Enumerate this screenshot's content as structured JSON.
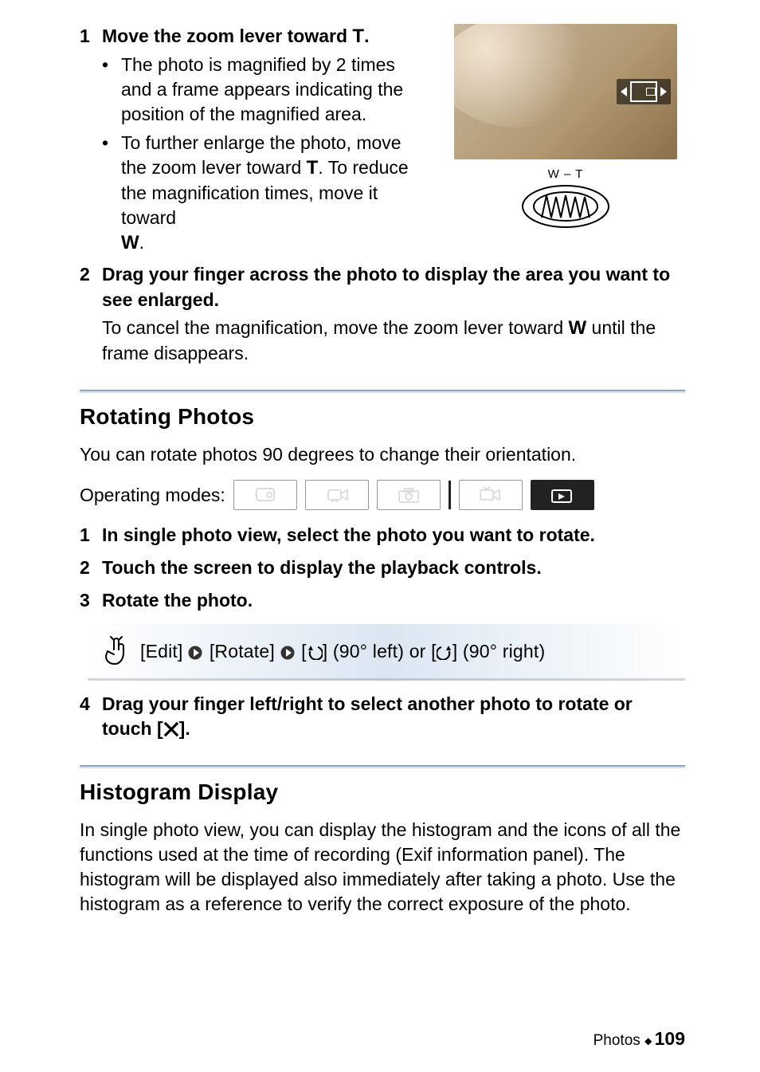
{
  "step1": {
    "num": "1",
    "head_a": "Move the zoom lever toward ",
    "head_b": ".",
    "bullet1": "The photo is magnified by 2 times and a frame appears indicating the position of the magnified area.",
    "bullet2_a": "To further enlarge the photo, move the zoom lever toward ",
    "bullet2_b": ". To reduce the magnification times, move it toward ",
    "bullet2_c": "."
  },
  "wt_label": "W – T",
  "step2": {
    "num": "2",
    "head": "Drag your finger across the photo to display the area you want to see enlarged.",
    "body_a": "To cancel the magnification, move the zoom lever toward ",
    "body_b": " until the frame disappears."
  },
  "rotate": {
    "title": "Rotating Photos",
    "intro": "You can rotate photos 90 degrees to change their orientation.",
    "modes_label": "Operating modes:",
    "s1_num": "1",
    "s1": "In single photo view, select the photo you want to rotate.",
    "s2_num": "2",
    "s2": "Touch the screen to display the playback controls.",
    "s3_num": "3",
    "s3": "Rotate the photo.",
    "callout_edit": "[Edit]",
    "callout_rotate": "[Rotate]",
    "callout_left": "] (90° left) or [",
    "callout_right": "] (90°  right)",
    "s4_num": "4",
    "s4_a": "Drag your finger left/right to select another photo to rotate or touch [",
    "s4_b": "]."
  },
  "histogram": {
    "title": "Histogram Display",
    "para": "In single photo view, you can display the histogram and the icons of all the functions used at the time of recording (Exif information panel). The histogram will be displayed also immediately after taking a photo. Use the histogram as a reference to verify the correct exposure of the photo."
  },
  "footer": {
    "section": "Photos",
    "page": "109"
  }
}
